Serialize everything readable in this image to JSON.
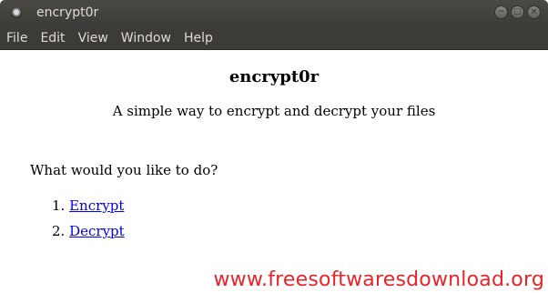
{
  "window": {
    "title": "encrypt0r"
  },
  "menu": {
    "items": [
      {
        "label": "File"
      },
      {
        "label": "Edit"
      },
      {
        "label": "View"
      },
      {
        "label": "Window"
      },
      {
        "label": "Help"
      }
    ]
  },
  "content": {
    "heading": "encrypt0r",
    "subtitle": "A simple way to encrypt and decrypt your files",
    "question": "What would you like to do?",
    "options": [
      {
        "number": "1.",
        "label": "Encrypt"
      },
      {
        "number": "2.",
        "label": "Decrypt"
      }
    ]
  },
  "watermark": "www.freesoftwaresdownload.org",
  "colors": {
    "titlebar": "#3c3b37",
    "link": "#0000ee",
    "watermark": "#e8242a"
  }
}
